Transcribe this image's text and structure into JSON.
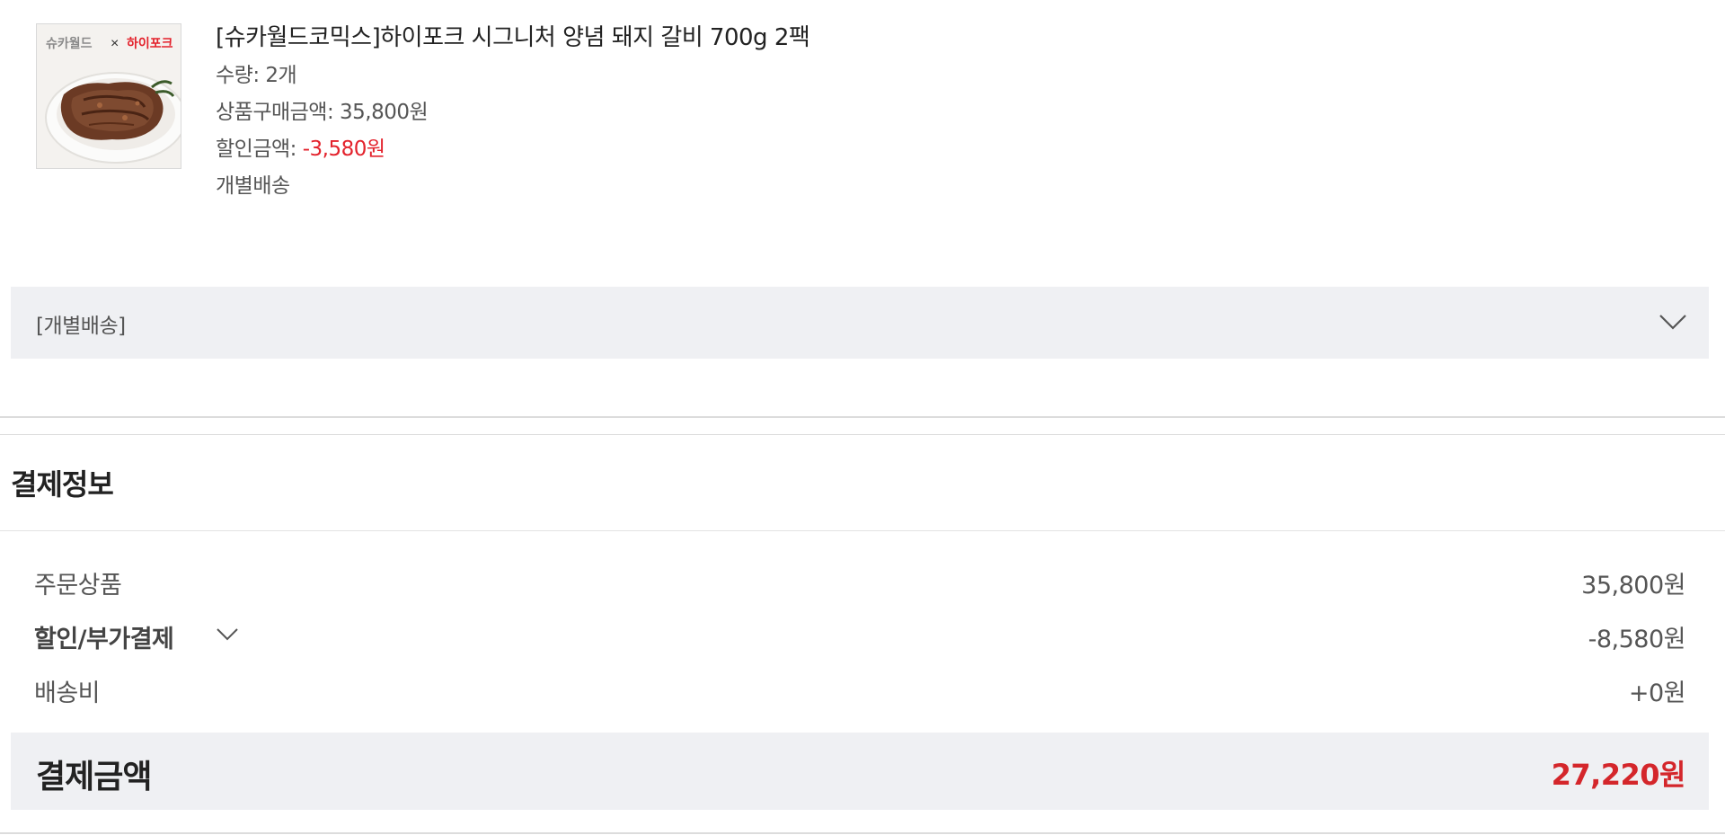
{
  "product": {
    "title": "[슈카월드코믹스]하이포크 시그니처 양념 돼지 갈비 700g 2팩",
    "quantity": "수량: 2개",
    "price_label": "상품구매금액: ",
    "price_value": "35,800원",
    "discount_label": "할인금액: ",
    "discount_value": "-3,580원",
    "shipping_type": "개별배송",
    "image": {
      "icon": "product-image",
      "logo_left": "슈카월드",
      "logo_x": "×",
      "logo_right": "하이포크"
    }
  },
  "delivery_bar": {
    "label": "[개별배송]",
    "icon": "chevron-down-icon"
  },
  "payment": {
    "title": "결제정보",
    "rows": [
      {
        "label": "주문상품",
        "value": "35,800원"
      },
      {
        "label": "할인/부가결제",
        "value": "-8,580원"
      },
      {
        "label": "배송비",
        "value": "+0원"
      }
    ],
    "total_label": "결제금액",
    "total_value": "27,220원"
  },
  "colors": {
    "discount_red": "#e3222c",
    "total_red": "#d4262b",
    "bar_gray": "#eff0f3"
  }
}
